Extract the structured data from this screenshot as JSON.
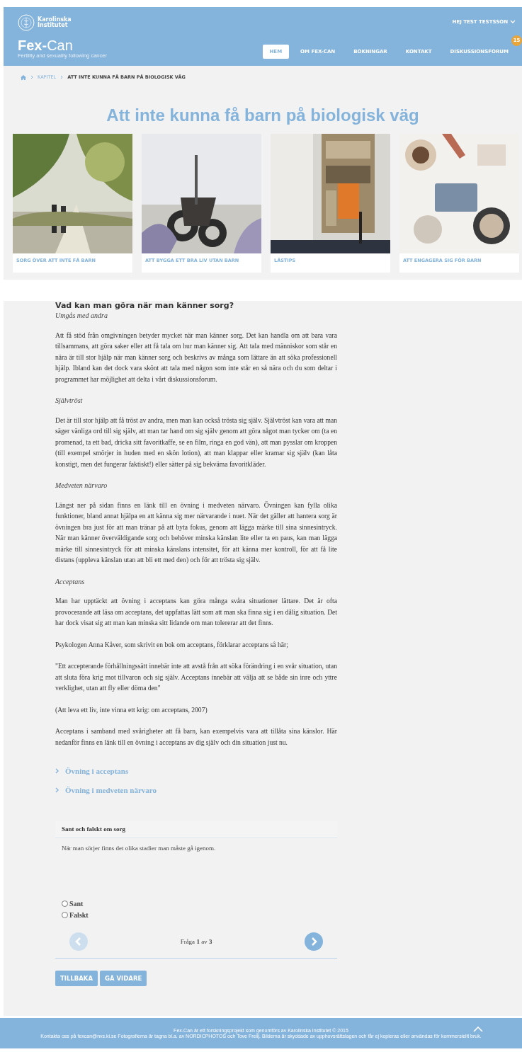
{
  "header": {
    "logo": {
      "institution_line1": "Karolinska",
      "institution_line2": "Institutet",
      "brand_bold": "Fex-",
      "brand_light": "Can",
      "tagline": "Fertility and sexuality following cancer"
    },
    "user_menu": "HEJ TEST TESTSSON",
    "nav": [
      {
        "label": "HEM",
        "selected": true
      },
      {
        "label": "OM FEX-CAN",
        "selected": false
      },
      {
        "label": "BOKNINGAR",
        "selected": false
      },
      {
        "label": "KONTAKT",
        "selected": false
      },
      {
        "label": "DISKUSSIONSFORUM",
        "selected": false,
        "badge": "15"
      }
    ]
  },
  "breadcrumb": [
    {
      "label": "KAPITEL",
      "kind": "link"
    },
    {
      "label": "ATT INTE KUNNA FÅ BARN PÅ BIOLOGISK VÄG",
      "kind": "current"
    }
  ],
  "page_title": "Att inte kunna få barn på biologisk väg",
  "cards": [
    {
      "label": "SORG ÖVER ATT INTE FÅ BARN"
    },
    {
      "label": "ATT BYGGA ETT BRA LIV UTAN BARN"
    },
    {
      "label": "LÄSTIPS"
    },
    {
      "label": "ATT ENGAGERA SIG FÖR BARN"
    }
  ],
  "article": {
    "heading": "Vad kan man göra när man känner sorg?",
    "blocks": [
      {
        "kind": "subheading",
        "text": "Umgås med andra"
      },
      {
        "kind": "paragraph",
        "text": "Att få stöd från omgivningen betyder mycket när man känner sorg. Det kan handla om att bara vara tillsammans, att göra saker eller att få tala om hur man känner sig. Att tala med människor som står en nära är till stor hjälp när man känner sorg och beskrivs av många som lättare än att söka professionell hjälp. Ibland kan det dock vara skönt att tala med någon som inte står en så nära och du som deltar i programmet har möjlighet att delta i vårt diskussionsforum."
      },
      {
        "kind": "subheading",
        "text": "Självtröst"
      },
      {
        "kind": "paragraph",
        "text": "Det är till stor hjälp att få tröst av andra, men man kan också trösta sig själv. Självtröst kan vara att man säger vänliga ord till sig själv, att man tar hand om sig själv genom att göra något man tycker om (ta en promenad, ta ett bad, dricka sitt favoritkaffe, se en film, ringa en god vän), att man pysslar om kroppen (till exempel smörjer in huden med en skön lotion), att man klappar eller kramar sig själv (kan låta konstigt, men det fungerar faktiskt!) eller sätter på sig bekväma favoritkläder."
      },
      {
        "kind": "subheading",
        "text": "Medveten närvaro"
      },
      {
        "kind": "paragraph",
        "text": "Längst ner på sidan finns en länk till en övning i medveten närvaro. Övningen kan fylla olika funktioner, bland annat hjälpa en att känna sig mer närvarande i nuet. När det gäller att hantera sorg är övningen bra just för att man tränar på att byta fokus, genom att lägga märke till sina sinnesintryck. När man känner överväldigande sorg och behöver minska känslan lite eller ta en paus, kan man lägga märke till sinnesintryck för att minska känslans intensitet, för att känna mer kontroll, för att få lite distans (uppleva känslan utan att bli ett med den) och för att trösta sig själv."
      },
      {
        "kind": "subheading",
        "text": "Acceptans"
      },
      {
        "kind": "paragraph",
        "text": "Man har upptäckt att övning i acceptans kan göra många svåra situationer lättare. Det är ofta provocerande att läsa om acceptans, det uppfattas lätt som att man ska finna sig i en dålig situation. Det har dock visat sig att man kan minska sitt lidande om man tolererar att det finns."
      },
      {
        "kind": "paragraph",
        "text": "Psykologen Anna Kåver, som skrivit en bok om acceptans, förklarar acceptans så här;"
      },
      {
        "kind": "paragraph",
        "text": "\"Ett accepterande förhållningssätt innebär inte att avstå från att söka förändring i en svår situation, utan att sluta föra krig mot tillvaron och sig själv. Acceptans innebär att välja att se både sin inre och yttre verklighet, utan att fly eller döma den\""
      },
      {
        "kind": "paragraph",
        "text": "(Att leva ett liv, inte vinna ett krig: om acceptans, 2007)"
      },
      {
        "kind": "paragraph",
        "text": "Acceptans i samband med svårigheter att få barn, kan exempelvis vara att tillåta sina känslor. Här nedanför finns en länk till en övning i acceptans av dig själv och din situation just nu."
      }
    ]
  },
  "exercise_links": [
    "Övning i acceptans",
    "Övning i medveten närvaro"
  ],
  "quiz": {
    "title": "Sant och falskt om sorg",
    "question": "När man sörjer finns det olika stadier man måste gå igenom.",
    "options": [
      {
        "label": "Sant",
        "selected": false
      },
      {
        "label": "Falskt",
        "selected": false
      }
    ],
    "counter": "Fråga **1** av **3**",
    "prev_disabled": true,
    "next_disabled": false
  },
  "buttons": [
    "TILLBAKA",
    "GÅ VIDARE"
  ],
  "footer": {
    "line1": "Fex-Can är ett forskningsprojekt som genomförs av Karolinska Institutet © 2015",
    "line2": "Kontakta oss på fexcan@nvs.ki.se Fotografierna är tagna bl.a. av NORDICPHOTOS och Tove Freiij. Bilderna är skyddade av upphovsrättslagen och får ej kopieras eller användas för kommersiellt bruk."
  }
}
